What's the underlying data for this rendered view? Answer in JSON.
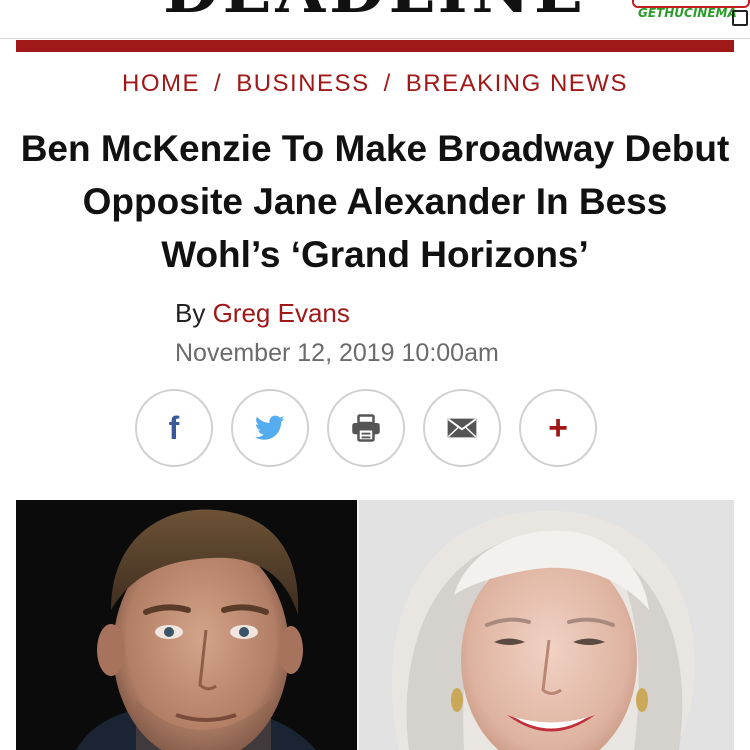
{
  "masthead": {
    "logo_text": "DEADLINE",
    "watermark_text": "GETHUCINEMA"
  },
  "breadcrumb": {
    "items": [
      "HOME",
      "BUSINESS",
      "BREAKING NEWS"
    ],
    "separator": "/"
  },
  "article": {
    "headline": "Ben McKenzie To Make Broadway Debut Opposite Jane Alexander In Bess Wohl’s ‘Grand Horizons’",
    "byline_prefix": "By",
    "author": "Greg Evans",
    "date": "November 12, 2019 10:00am"
  },
  "share": {
    "facebook_glyph": "f",
    "more_glyph": "+",
    "icons": [
      "facebook-icon",
      "twitter-icon",
      "print-icon",
      "email-icon",
      "plus-icon"
    ]
  },
  "colors": {
    "brand_red": "#a01818",
    "facebook": "#3b5998",
    "twitter": "#55acee",
    "icon_gray": "#555555"
  }
}
